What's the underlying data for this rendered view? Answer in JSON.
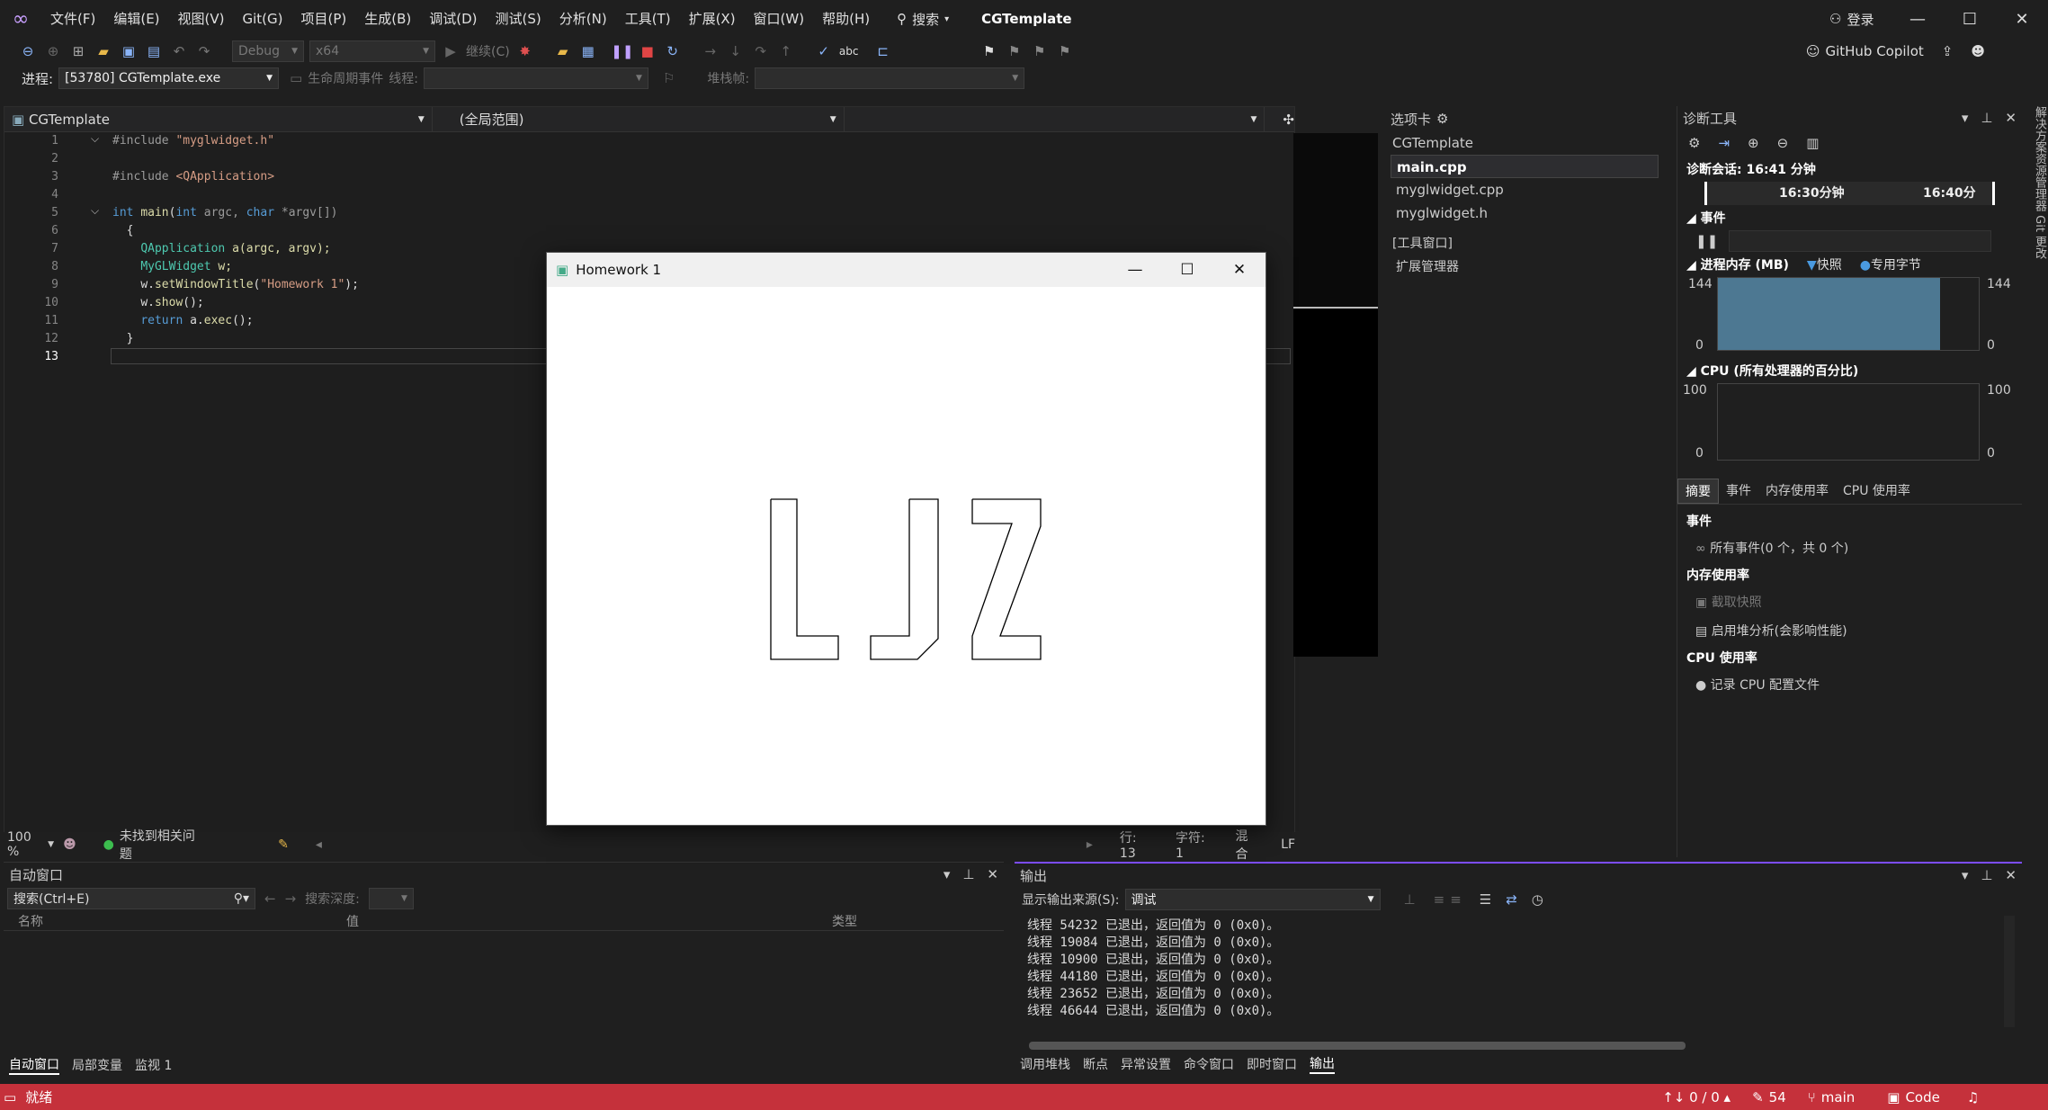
{
  "menu": {
    "items": [
      "文件(F)",
      "编辑(E)",
      "视图(V)",
      "Git(G)",
      "项目(P)",
      "生成(B)",
      "调试(D)",
      "测试(S)",
      "分析(N)",
      "工具(T)",
      "扩展(X)",
      "窗口(W)",
      "帮助(H)"
    ],
    "search": "搜索",
    "app_title": "CGTemplate",
    "login": "登录"
  },
  "toolbar": {
    "config": "Debug",
    "platform": "x64",
    "continue": "继续(C)",
    "copilot": "GitHub Copilot"
  },
  "toolbar2": {
    "process_label": "进程:",
    "process_value": "[53780] CGTemplate.exe",
    "lifecycle": "生命周期事件",
    "thread_label": "线程:",
    "stack_label": "堆栈帧:"
  },
  "editor": {
    "file_scope": "CGTemplate",
    "global_scope": "(全局范围)",
    "zoom": "100 %",
    "issues": "未找到相关问题",
    "line": "行: 13",
    "char": "字符: 1",
    "mixed": "混合",
    "eol": "LF",
    "line_numbers": [
      "1",
      "2",
      "3",
      "4",
      "5",
      "6",
      "7",
      "8",
      "9",
      "10",
      "11",
      "12",
      "13"
    ]
  },
  "code": {
    "l1a": "#include ",
    "l1b": "\"myglwidget.h\"",
    "l3a": "#include ",
    "l3b": "<QApplication>",
    "l5a": "int ",
    "l5b": "main",
    "l5c": "(",
    "l5d": "int ",
    "l5e": "argc, ",
    "l5f": "char ",
    "l5g": "*argv[])",
    "l6": "{",
    "l7a": "QApplication ",
    "l7b": "a(argc, argv);",
    "l8a": "MyGLWidget ",
    "l8b": "w;",
    "l9a": "w.",
    "l9b": "setWindowTitle",
    "l9c": "(",
    "l9d": "\"Homework 1\"",
    "l9e": ");",
    "l10a": "w.",
    "l10b": "show",
    "l10c": "();",
    "l11a": "return ",
    "l11b": "a.",
    "l11c": "exec",
    "l11d": "();",
    "l12": "}"
  },
  "solution": {
    "header": "选项卡",
    "project": "CGTemplate",
    "files": [
      "main.cpp",
      "myglwidget.cpp",
      "myglwidget.h"
    ],
    "tool_window": "[工具窗口]",
    "ext_manager": "扩展管理器"
  },
  "diagnostics": {
    "title": "诊断工具",
    "session": "诊断会话: 16:41 分钟",
    "tick1": "16:30分钟",
    "tick2": "16:40分",
    "events": "事件",
    "memory": "进程内存 (MB)",
    "snapshot": "快照",
    "private_bytes": "专用字节",
    "mem_max": "144",
    "mem_min": "0",
    "cpu": "CPU (所有处理器的百分比)",
    "cpu_max": "100",
    "cpu_min": "0",
    "tabs": [
      "摘要",
      "事件",
      "内存使用率",
      "CPU 使用率"
    ],
    "events_title": "事件",
    "all_events": "所有事件(0 个，共 0 个)",
    "mem_title": "内存使用率",
    "take_snapshot": "截取快照",
    "heap": "启用堆分析(会影响性能)",
    "cpu_title": "CPU 使用率",
    "record_cpu": "记录 CPU 配置文件"
  },
  "right_strip": "解决方案资源管理器  Git 更改",
  "autos": {
    "title": "自动窗口",
    "search": "搜索(Ctrl+E)",
    "depth": "搜索深度:",
    "col_name": "名称",
    "col_value": "值",
    "col_type": "类型",
    "tabs": [
      "自动窗口",
      "局部变量",
      "监视 1"
    ]
  },
  "output": {
    "title": "输出",
    "source_label": "显示输出来源(S):",
    "source": "调试",
    "lines": [
      "线程 54232 已退出，返回值为 0 (0x0)。",
      "线程 19084 已退出，返回值为 0 (0x0)。",
      "线程 10900 已退出，返回值为 0 (0x0)。",
      "线程 44180 已退出，返回值为 0 (0x0)。",
      "线程 23652 已退出，返回值为 0 (0x0)。",
      "线程 46644 已退出，返回值为 0 (0x0)。"
    ],
    "tabs": [
      "调用堆栈",
      "断点",
      "异常设置",
      "命令窗口",
      "即时窗口",
      "输出"
    ]
  },
  "status": {
    "ready": "就绪",
    "lines": "↑↓ 0 / 0 ▴",
    "edits": "54",
    "branch": "main",
    "code": "Code"
  },
  "qt": {
    "title": "Homework 1"
  }
}
